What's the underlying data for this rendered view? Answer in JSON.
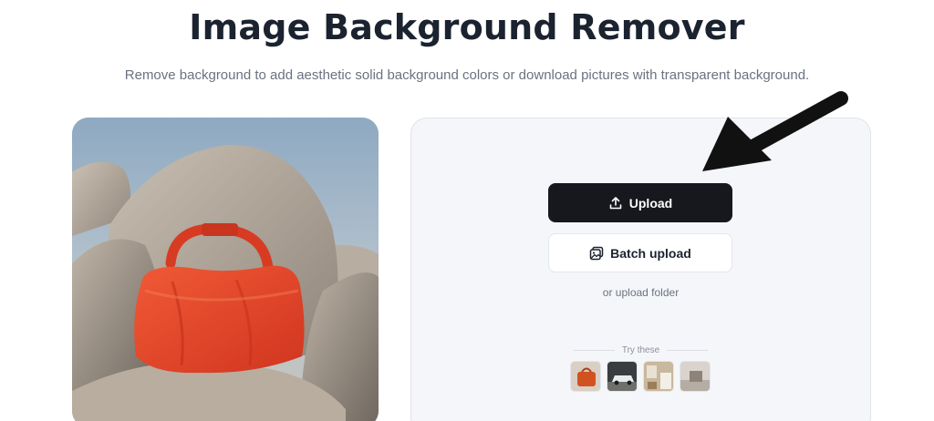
{
  "header": {
    "title": "Image Background Remover",
    "subtitle": "Remove background to add aesthetic solid background colors or download pictures with transparent background."
  },
  "upload_panel": {
    "upload_label": "Upload",
    "batch_upload_label": "Batch upload",
    "folder_link": "or upload folder",
    "try_label": "Try these",
    "samples": [
      "bag-sample",
      "car-sample",
      "room-sample",
      "product-sample"
    ]
  },
  "colors": {
    "primary_button": "#16181d",
    "panel_bg": "#f5f6f9",
    "bag": "#e8432a"
  }
}
